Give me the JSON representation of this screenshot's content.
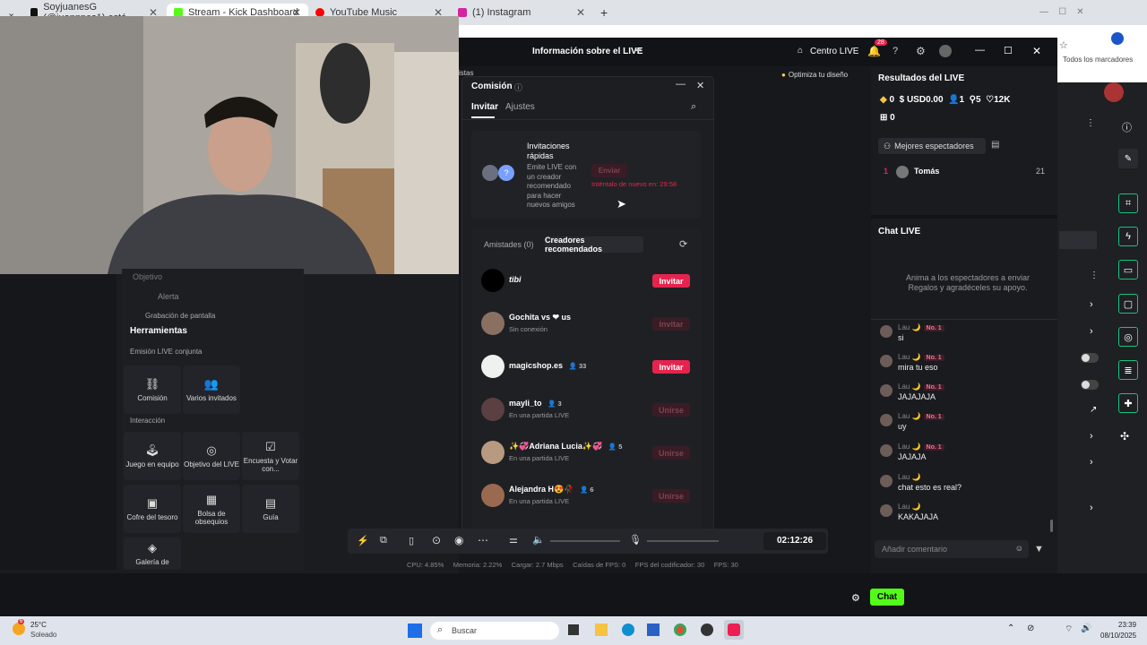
{
  "browser": {
    "tabs": [
      {
        "title": "SoyjuanesG (@juannnes1) está"
      },
      {
        "title": "Stream - Kick Dashboard"
      },
      {
        "title": "YouTube Music"
      },
      {
        "title": "(1) Instagram"
      }
    ],
    "bookmarks_label": "Todos los marcadores",
    "new_tab": "+"
  },
  "studio": {
    "header_title": "Información sobre el LIVE",
    "centro_live": "Centro LIVE",
    "notif_count": "28",
    "optimize": "Optimiza tu diseño",
    "partial_left": "istas"
  },
  "modal": {
    "title": "Comisión",
    "tabs": [
      "Invitar",
      "Ajustes"
    ],
    "quick": {
      "title": "Invitaciones rápidas",
      "desc": "Emite LIVE con un creador recomendado para hacer nuevos amigos",
      "send": "Enviar",
      "retry": "Inténtalo de nuevo en: 29:58"
    },
    "subtabs": [
      "Amistades (0)",
      "Creadores recomendados"
    ],
    "creators": [
      {
        "name": "tibi",
        "sub": "",
        "count": "",
        "action": "Invitar",
        "active": true
      },
      {
        "name": "Gochita vs ❤ us",
        "sub": "Sin conexión",
        "count": "",
        "action": "Invitar",
        "active": false
      },
      {
        "name": "magicshop.es",
        "sub": "",
        "count": "33",
        "action": "Invitar",
        "active": true
      },
      {
        "name": "mayli_to",
        "sub": "En una partida LIVE",
        "count": "3",
        "action": "Unirse",
        "active": false
      },
      {
        "name": "✨💞Adriana Lucia✨💞",
        "sub": "En una partida LIVE",
        "count": "5",
        "action": "Unirse",
        "active": false
      },
      {
        "name": "Alejandra H😍🥀",
        "sub": "En una partida LIVE",
        "count": "6",
        "action": "Unirse",
        "active": false
      }
    ]
  },
  "tools": {
    "partial_items": [
      "Objetivo",
      "Alerta",
      "Grabación de pantalla"
    ],
    "title": "Herramientas",
    "section1": "Emisión LIVE conjunta",
    "section1_items": [
      "Comisión",
      "Varios invitados"
    ],
    "section2": "Interacción",
    "section2_items": [
      "Juego en equipo",
      "Objetivo del LIVE",
      "Encuesta y Votar con...",
      "Cofre del tesoro",
      "Bolsa de obsequios",
      "Guía",
      "Galería de"
    ]
  },
  "results": {
    "title": "Resultados del LIVE",
    "stats": [
      "0",
      "USD0.00",
      "1",
      "5",
      "12K",
      "0"
    ],
    "best_viewers": "Mejores espectadores",
    "top": [
      {
        "rank": "1",
        "name": "Tomás",
        "score": "21"
      }
    ]
  },
  "chat": {
    "title": "Chat LIVE",
    "empty_hint": "Anima a los espectadores a enviar Regalos y agradéceles su apoyo.",
    "messages": [
      {
        "user": "Lau 🌙",
        "badge": "No. 1",
        "text": "si"
      },
      {
        "user": "Lau 🌙",
        "badge": "No. 1",
        "text": "mira tu eso"
      },
      {
        "user": "Lau 🌙",
        "badge": "No. 1",
        "text": "JAJAJAJA"
      },
      {
        "user": "Lau 🌙",
        "badge": "No. 1",
        "text": "uy"
      },
      {
        "user": "Lau 🌙",
        "badge": "No. 1",
        "text": "JAJAJA"
      },
      {
        "user": "Lau 🌙",
        "badge": "",
        "text": "chat esto es real?"
      },
      {
        "user": "Lau 🌙",
        "badge": "",
        "text": "KAKAJAJA"
      }
    ],
    "input_placeholder": "Añadir comentario",
    "chat_button": "Chat"
  },
  "controls": {
    "timer": "02:12:26"
  },
  "status": {
    "cpu": "CPU: 4.85%",
    "mem": "Memoria: 2.22%",
    "load": "Cargar: 2.7 Mbps",
    "fps_drop": "Caídas de FPS: 0",
    "enc_fps": "FPS del codificador: 30",
    "fps": "FPS: 30"
  },
  "taskbar": {
    "weather_temp": "25°C",
    "weather_desc": "Soleado",
    "weather_badge": "6",
    "search": "Buscar",
    "time": "23:39",
    "date": "08/10/2025"
  },
  "colors": {
    "accent": "#e5244e",
    "kick_green": "#53fc18",
    "status_green": "#19c37d"
  }
}
